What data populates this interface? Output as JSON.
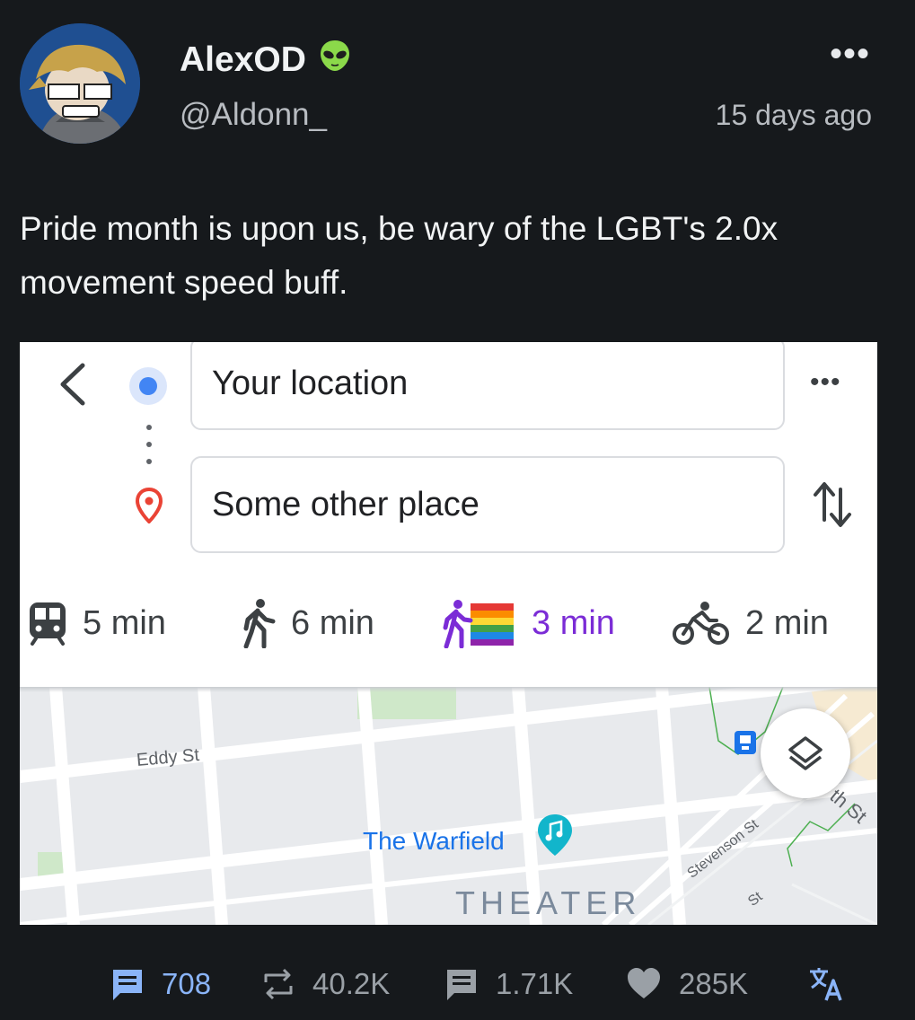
{
  "post": {
    "author_name": "AlexOD",
    "author_badge": "alien-emoji",
    "handle": "@Aldonn_",
    "timestamp": "15 days ago",
    "text": "Pride month is upon us, be wary of the LGBT's 2.0x movement speed buff."
  },
  "maps": {
    "origin": "Your location",
    "destination": "Some other place",
    "modes": [
      {
        "mode": "transit",
        "time": "5 min"
      },
      {
        "mode": "walk",
        "time": "6 min"
      },
      {
        "mode": "pride-walk",
        "time": "3 min"
      },
      {
        "mode": "bike",
        "time": "2 min"
      }
    ],
    "map_labels": {
      "street_1": "Eddy St",
      "venue": "The Warfield",
      "venue_type": "THEATER",
      "street_2": "Stevenson St",
      "street_3": "th St",
      "street_4": "St"
    }
  },
  "actions": {
    "replies": "708",
    "reposts": "40.2K",
    "quotes": "1.71K",
    "likes": "285K"
  },
  "colors": {
    "background": "#16191c",
    "accent": "#8ab4f8",
    "active_mode": "#7b2cd6",
    "map_blue": "#4285f4",
    "pin_red": "#ea4335"
  }
}
